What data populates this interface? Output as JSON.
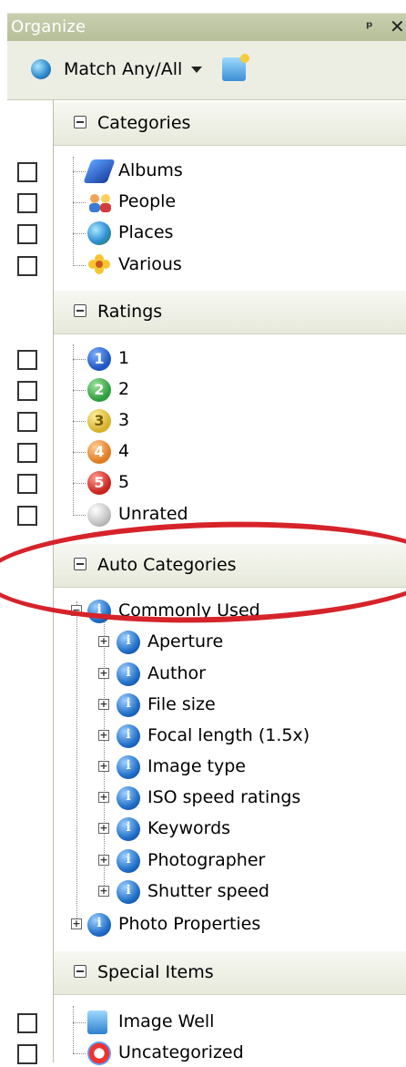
{
  "window": {
    "title": "Organize"
  },
  "toolbar": {
    "match_label": "Match Any/All"
  },
  "sections": {
    "categories": {
      "title": "Categories",
      "items": [
        "Albums",
        "People",
        "Places",
        "Various"
      ]
    },
    "ratings": {
      "title": "Ratings",
      "items": [
        "1",
        "2",
        "3",
        "4",
        "5",
        "Unrated"
      ]
    },
    "auto": {
      "title": "Auto Categories",
      "root": "Commonly Used",
      "children": [
        "Aperture",
        "Author",
        "File size",
        "Focal length (1.5x)",
        "Image type",
        "ISO speed ratings",
        "Keywords",
        "Photographer",
        "Shutter speed"
      ],
      "sibling": "Photo Properties"
    },
    "special": {
      "title": "Special Items",
      "items": [
        "Image Well",
        "Uncategorized"
      ]
    }
  },
  "rating_badges": [
    "1",
    "2",
    "3",
    "4",
    "5"
  ],
  "colors": {
    "titlebar": "#b6bf98",
    "highlight": "#d6232a",
    "rating1": "#1f57c0",
    "rating2": "#2f9e3f",
    "rating3": "#d6b22b",
    "rating4": "#e07b21",
    "rating5": "#c8241f"
  }
}
